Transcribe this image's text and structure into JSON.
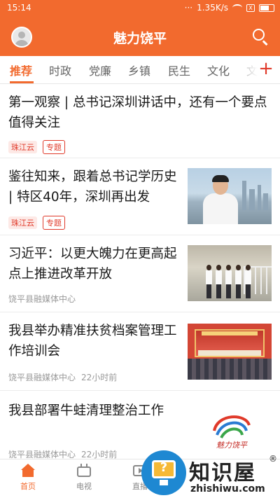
{
  "status_bar": {
    "time": "15:14",
    "network_speed": "1.35K/s",
    "sim_label": "X"
  },
  "header": {
    "title": "魅力饶平"
  },
  "tabs": [
    "推荐",
    "时政",
    "党廉",
    "乡镇",
    "民生",
    "文化",
    "文"
  ],
  "add_tab_label": "+",
  "news": [
    {
      "title": "第一观察 | 总书记深圳讲话中，还有一个要点值得关注",
      "source_tag": "珠江云",
      "special_tag": "专题"
    },
    {
      "title": "鉴往知来，跟着总书记学历史 | 特区40年，深圳再出发",
      "source_tag": "珠江云",
      "special_tag": "专题"
    },
    {
      "title": "习近平：以更大魄力在更高起点上推进改革开放",
      "source": "饶平县融媒体中心"
    },
    {
      "title": "我县举办精准扶贫档案管理工作培训会",
      "source": "饶平县融媒体中心",
      "time": "22小时前"
    },
    {
      "title": "我县部署牛蛙清理整治工作",
      "source": "饶平县融媒体中心",
      "time": "22小时前"
    }
  ],
  "logo_text": "魅力饶平",
  "bottom_nav": [
    {
      "label": "首页",
      "icon": "home-icon",
      "active": true
    },
    {
      "label": "电视",
      "icon": "tv-icon",
      "active": false
    },
    {
      "label": "直播",
      "icon": "live-icon",
      "active": false
    }
  ],
  "watermark": {
    "text": "知识屋",
    "url": "zhishiwu.com",
    "mark": "®"
  },
  "colors": {
    "brand": "#f26a2e",
    "tag_red": "#e03a2a"
  }
}
